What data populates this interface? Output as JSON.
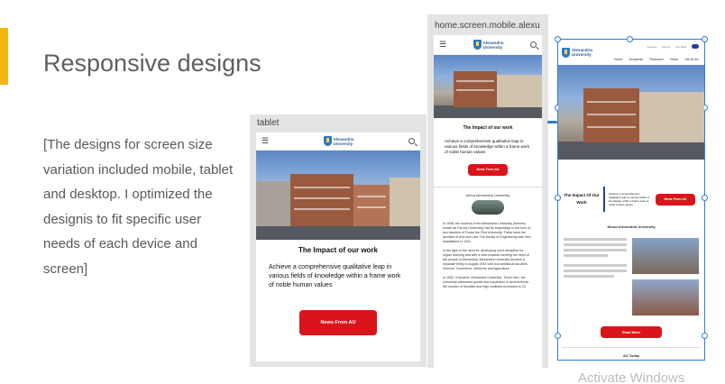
{
  "slide": {
    "title": "Responsive designs",
    "body": "[The designs for screen size variation included mobile, tablet and desktop. I optimized the designis to fit specific user needs of each device and screen]"
  },
  "tablet": {
    "label": "tablet",
    "logo": "Alexandria\nUniversity",
    "impact_title": "The Impact of our work",
    "impact_text": "Achieve a comprehensive qualitative leap in various fields of knowledge within a frame work of noble human values",
    "news_button": "News From AU"
  },
  "mobile": {
    "label": "home.screen.mobile.alexu",
    "logo": "Alexandria\nUniversity",
    "impact_title": "The Impact of our work",
    "impact_text": "Achieve a comprehensive qualitative leap in various fields of knowledge within a frame work of noble human values",
    "news_button": "News From AU",
    "about_title": "About Alexandria University",
    "history_p1": "In 1938, the nucleus of the Alexandria University (formerly known as Farouk University) had its beginnings in the form of two faculties of Fouad the First University. These were the faculties of Arts and Law. The faculty of Engineering was then established in 1941.",
    "history_p2": "In the light of the need for developing more discipline for higher learning and with a view towards meeting the need of the people of Alexandria, Alexandria University became a separate entity in August 1942 with four additional faculties: Science, Commerce, Medicine and Agriculture.",
    "history_p3": "In 1952, it became 'Alexandria University'. Since then, the University witnessed growth and expansion in several fields: the number of faculties and high institutes increased to 22."
  },
  "desktop": {
    "logo": "Alexandria\nUniversity",
    "top_menu": [
      "Careers",
      "Alumni",
      "Our Blog"
    ],
    "menu": [
      "Home",
      "Academic",
      "Research",
      "Views",
      "Life At AU"
    ],
    "impact_title": "The Impact Of Our Work",
    "impact_text": "Achieve a comprehensive qualitative leap in various fields of knowledge within a frame work of noble human values",
    "news_button": "News From AU",
    "about_title": "About Alexandria University",
    "read_more": "Read More",
    "au_today": "AU Today"
  },
  "watermark": "Activate Windows"
}
